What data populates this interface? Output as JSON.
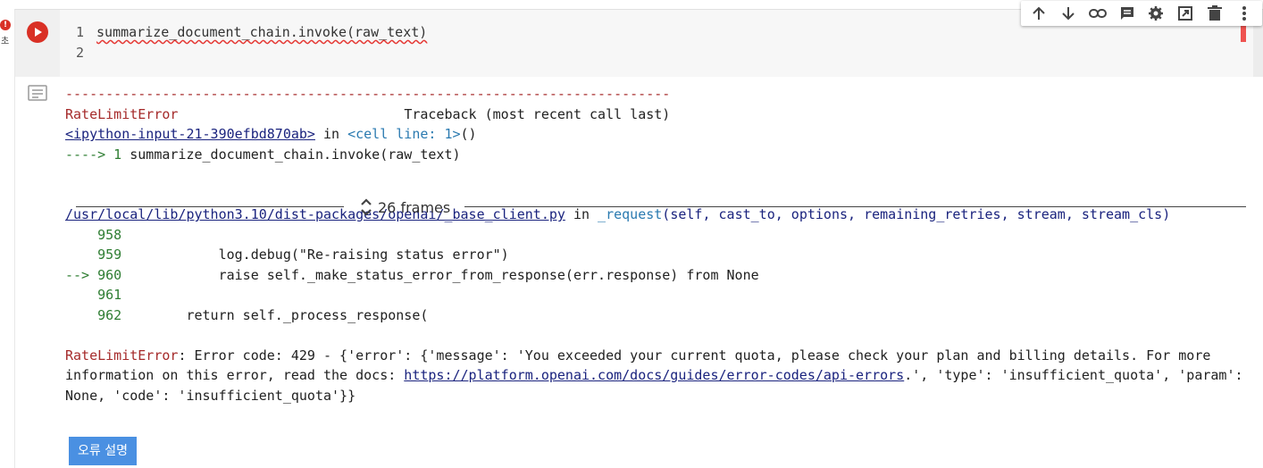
{
  "gutter": {
    "badge": "!",
    "exec_time": "초"
  },
  "cell": {
    "code_lines": [
      {
        "num": "1",
        "text": "summarize_document_chain.invoke(raw_text)"
      },
      {
        "num": "2",
        "text": ""
      }
    ]
  },
  "toolbar": {
    "icons": [
      "arrow-up-icon",
      "arrow-down-icon",
      "link-icon",
      "comment-icon",
      "gear-icon",
      "mirror-icon",
      "trash-icon",
      "more-vert-icon"
    ]
  },
  "output": {
    "separator": "---------------------------------------------------------------------------",
    "error_name": "RateLimitError",
    "traceback_header": "Traceback (most recent call last)",
    "input_ref": "<ipython-input-21-390efbd870ab>",
    "in_word": " in ",
    "cell_line": "<cell line: 1>",
    "cell_line_tail": "()",
    "arrow_line_prefix": "----> 1 ",
    "arrow_line_code": "summarize_document_chain.invoke(raw_text)",
    "frames_label": "26 frames",
    "file_path": "/usr/local/lib/python3.10/dist-packages/openai/_base_client.py",
    "file_in": " in ",
    "func_name": "_request",
    "func_args": "(self, cast_to, options, remaining_retries, stream, stream_cls)",
    "src_lines": [
      {
        "prefix": "    ",
        "num": "958",
        "code": ""
      },
      {
        "prefix": "    ",
        "num": "959",
        "code": "            log.debug(\"Re-raising status error\")"
      },
      {
        "prefix": "--> ",
        "num": "960",
        "code": "            raise self._make_status_error_from_response(err.response) from None"
      },
      {
        "prefix": "    ",
        "num": "961",
        "code": ""
      },
      {
        "prefix": "    ",
        "num": "962",
        "code": "        return self._process_response("
      }
    ],
    "msg_name": "RateLimitError",
    "msg_part1": ": Error code: 429 - {'error': {'message': 'You exceeded your current quota, please check your plan and billing details. For more",
    "msg_part2_pre": "information on this error, read the docs: ",
    "msg_link": "https://platform.openai.com/docs/guides/error-codes/api-errors",
    "msg_part2_post": ".', 'type': 'insufficient_quota', 'param':",
    "msg_part3": "None, 'code': 'insufficient_quota'}}",
    "explain_button": "오류 설명"
  },
  "colors": {
    "run": "#d93025",
    "error_name": "#a52a2a",
    "link": "#1a237e",
    "button": "#4a90e2"
  }
}
